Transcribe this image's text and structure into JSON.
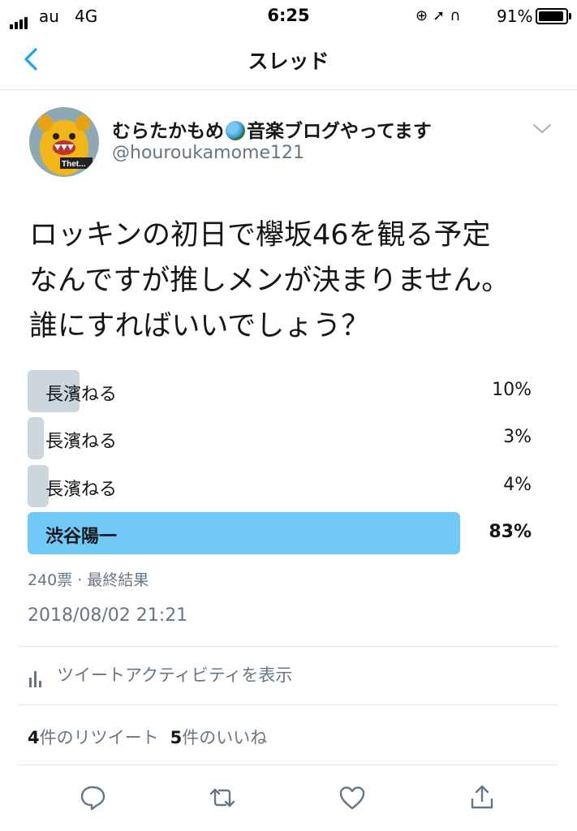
{
  "status": {
    "carrier": "au",
    "network": "4G",
    "time": "6:25",
    "battery_pct": "91%"
  },
  "nav": {
    "title": "スレッド"
  },
  "user": {
    "display_name_part1": "むらたかもめ",
    "display_name_part2": "音楽ブログやってます",
    "handle": "@houroukamome121",
    "avatar_label": "Thet..."
  },
  "tweet": {
    "text_line1": "ロッキンの初日で欅坂46を観る予定",
    "text_line2": "なんですが推しメンが決まりません。",
    "text_line3": "誰にすればいいでしょう？"
  },
  "poll": {
    "options": [
      {
        "label": "長濱ねる",
        "percent": "10%",
        "share": 0.1,
        "winner": false
      },
      {
        "label": "長濱ねる",
        "percent": "3%",
        "share": 0.03,
        "winner": false
      },
      {
        "label": "長濱ねる",
        "percent": "4%",
        "share": 0.04,
        "winner": false
      },
      {
        "label": "渋谷陽一",
        "percent": "83%",
        "share": 0.83,
        "winner": true
      }
    ],
    "meta": "240票 · 最終結果"
  },
  "timestamp": "2018/08/02 21:21",
  "activity_label": "ツイートアクティビティを表示",
  "stats": {
    "retweets_count": "4",
    "retweets_label": "件のリツイート",
    "likes_count": "5",
    "likes_label": "件のいいね"
  },
  "colors": {
    "accent": "#1da1f2",
    "poll_winner": "#71c9f8",
    "poll_other": "#ccd6dd",
    "secondary_text": "#657786"
  }
}
